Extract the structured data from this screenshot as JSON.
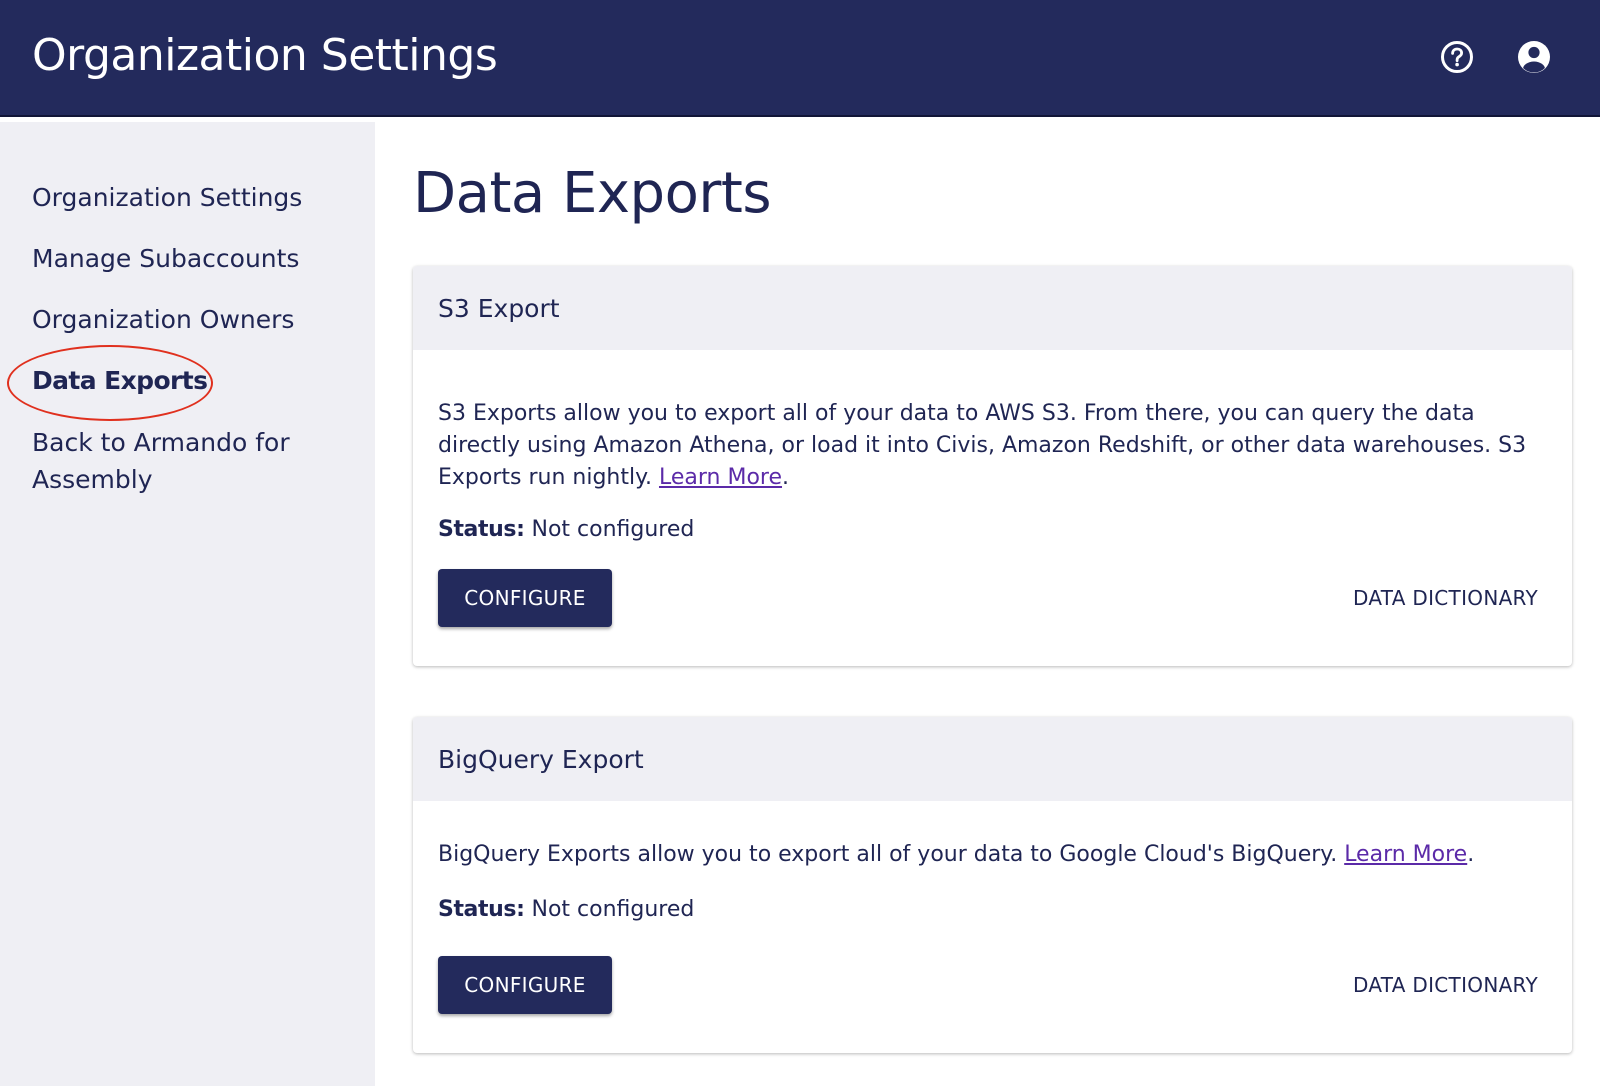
{
  "header": {
    "title": "Organization Settings",
    "help_icon": "help-circle-icon",
    "account_icon": "account-circle-icon",
    "bg_color": "#232a5c"
  },
  "sidebar": {
    "items": [
      {
        "label": "Organization Settings"
      },
      {
        "label": "Manage Subaccounts"
      },
      {
        "label": "Organization Owners"
      },
      {
        "label": "Data Exports",
        "active": true
      },
      {
        "label": "Back to Armando for Assembly"
      }
    ],
    "highlight_color": "#e0301e"
  },
  "main": {
    "page_title": "Data Exports",
    "cards": [
      {
        "title": "S3 Export",
        "description": "S3 Exports allow you to export all of your data to AWS S3. From there, you can query the data directly using Amazon Athena, or load it into Civis, Amazon Redshift, or other data warehouses. S3 Exports run nightly.",
        "learn_more": "Learn More",
        "suffix": ".",
        "status_label": "Status:",
        "status_value": "Not configured",
        "configure_label": "CONFIGURE",
        "dictionary_label": "DATA DICTIONARY"
      },
      {
        "title": "BigQuery Export",
        "description": "BigQuery Exports allow you to export all of your data to Google Cloud's BigQuery.",
        "learn_more": "Learn More",
        "suffix": ".",
        "status_label": "Status:",
        "status_value": "Not configured",
        "configure_label": "CONFIGURE",
        "dictionary_label": "DATA DICTIONARY"
      }
    ]
  }
}
